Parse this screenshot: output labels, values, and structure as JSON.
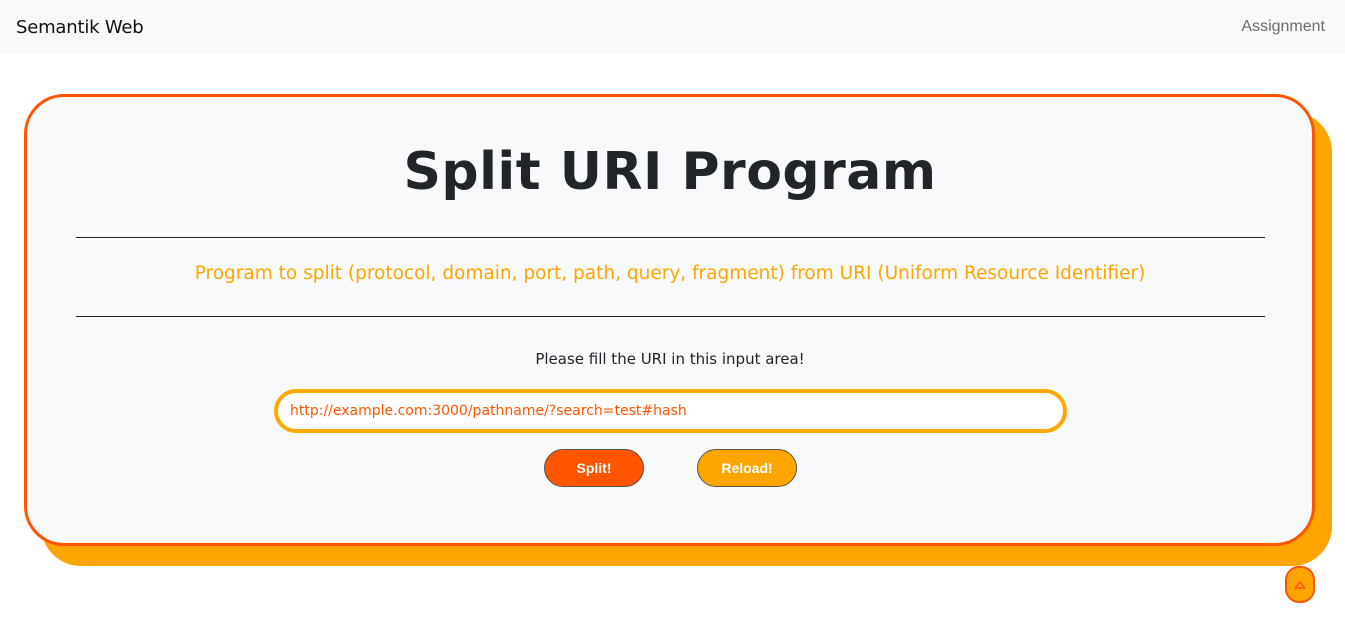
{
  "navbar": {
    "brand": "Semantik Web",
    "link": "Assignment"
  },
  "card": {
    "title": "Split URI Program",
    "subtitle": "Program to split (protocol, domain, port, path, query, fragment) from URI (Uniform Resource Identifier)",
    "prompt": "Please fill the URI in this input area!",
    "uri_value": "http://example.com:3000/pathname/?search=test#hash",
    "split_label": "Split!",
    "reload_label": "Reload!"
  },
  "scroll_top": {
    "icon": "chevron-up-icon"
  },
  "colors": {
    "accent_orange": "#ff5500",
    "accent_amber": "#ffa500",
    "text_dark": "#212529"
  }
}
